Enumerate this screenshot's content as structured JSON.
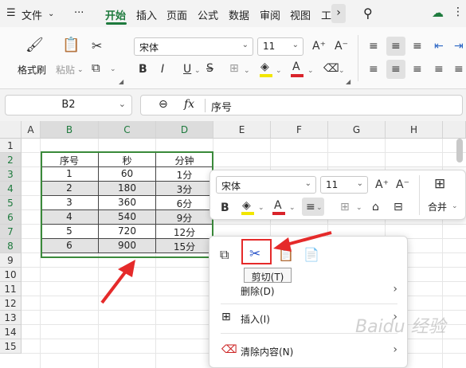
{
  "menubar": {
    "file_label": "文件",
    "more": "···",
    "tabs": [
      "开始",
      "插入",
      "页面",
      "公式",
      "数据",
      "审阅",
      "视图",
      "工"
    ]
  },
  "ribbon": {
    "format_painter": "格式刷",
    "paste": "粘贴",
    "font_name": "宋体",
    "font_size": "11"
  },
  "formula_bar": {
    "cell_ref": "B2",
    "fx": "fx",
    "content": "序号"
  },
  "grid": {
    "columns": [
      "A",
      "B",
      "C",
      "D",
      "E",
      "F",
      "G",
      "H"
    ],
    "rows": [
      "1",
      "2",
      "3",
      "4",
      "5",
      "6",
      "7",
      "8",
      "9",
      "10",
      "11",
      "12",
      "13",
      "14",
      "15"
    ],
    "table": [
      [
        "序号",
        "秒",
        "分钟"
      ],
      [
        "1",
        "60",
        "1分"
      ],
      [
        "2",
        "180",
        "3分"
      ],
      [
        "3",
        "360",
        "6分"
      ],
      [
        "4",
        "540",
        "9分"
      ],
      [
        "5",
        "720",
        "12分"
      ],
      [
        "6",
        "900",
        "15分"
      ]
    ]
  },
  "mini_toolbar": {
    "font_name": "宋体",
    "font_size": "11",
    "merge_label": "合并"
  },
  "context_menu": {
    "tooltip": "剪切(T)",
    "items": [
      "删除(D)",
      "插入(I)",
      "清除内容(N)"
    ]
  },
  "watermark": "Baidu 经验",
  "colors": {
    "accent_green": "#1e7a3d",
    "annotation_red": "#e52a2a",
    "highlight_yellow": "#f2e600",
    "font_red": "#d9232a"
  }
}
